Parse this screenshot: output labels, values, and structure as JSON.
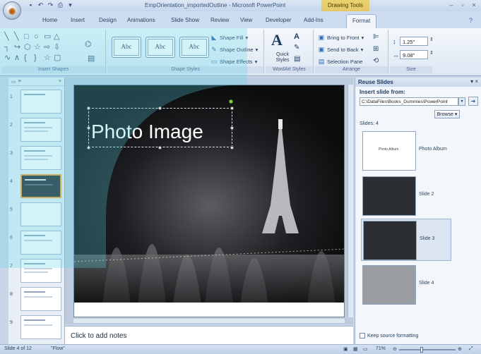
{
  "window": {
    "title": "EmpOrientation_importedOutline - Microsoft PowerPoint",
    "context_tools": "Drawing Tools",
    "controls": [
      "–",
      "▫",
      "×"
    ]
  },
  "tabs": [
    {
      "label": "Home"
    },
    {
      "label": "Insert"
    },
    {
      "label": "Design"
    },
    {
      "label": "Animations"
    },
    {
      "label": "Slide Show"
    },
    {
      "label": "Review"
    },
    {
      "label": "View"
    },
    {
      "label": "Developer"
    },
    {
      "label": "Add-Ins"
    },
    {
      "label": "Format"
    }
  ],
  "ribbon": {
    "insert_shapes": {
      "label": "Insert Shapes"
    },
    "shape_styles": {
      "label": "Shape Styles",
      "gallery": [
        "Abc",
        "Abc",
        "Abc"
      ],
      "fill": "Shape Fill",
      "outline": "Shape Outline",
      "effects": "Shape Effects"
    },
    "wordart": {
      "label": "WordArt Styles",
      "quick_styles": "Quick Styles"
    },
    "arrange": {
      "label": "Arrange",
      "bring_front": "Bring to Front",
      "send_back": "Send to Back",
      "selection_pane": "Selection Pane"
    },
    "size": {
      "label": "Size",
      "height": "1.25\"",
      "width": "9.08\""
    }
  },
  "slides_panel": {
    "slides": [
      {
        "num": "1"
      },
      {
        "num": "2"
      },
      {
        "num": "3"
      },
      {
        "num": "4"
      },
      {
        "num": "5"
      },
      {
        "num": "6"
      },
      {
        "num": "7"
      },
      {
        "num": "8"
      },
      {
        "num": "9"
      }
    ]
  },
  "slide": {
    "title": "Photo Image"
  },
  "notes": {
    "placeholder": "Click to add notes"
  },
  "reuse": {
    "title": "Reuse Slides",
    "insert_from": "Insert slide from:",
    "path": "C:\\DataFiles\\Books_Dummies\\PowerPoint",
    "browse": "Browse",
    "slides_count": "Slides: 4",
    "items": [
      {
        "label": "Photo Album",
        "mini": "Photo Album"
      },
      {
        "label": "Slide 2"
      },
      {
        "label": "Slide 3"
      },
      {
        "label": "Slide 4"
      }
    ],
    "keep_formatting": "Keep source formatting"
  },
  "status": {
    "slide_info": "Slide 4 of 12",
    "theme": "\"Flow\"",
    "zoom": "71%"
  },
  "colors": {
    "ribbon_bg": "#dde7f3",
    "context_tab": "#e5c76a",
    "overlay": "#5fd6ea"
  }
}
